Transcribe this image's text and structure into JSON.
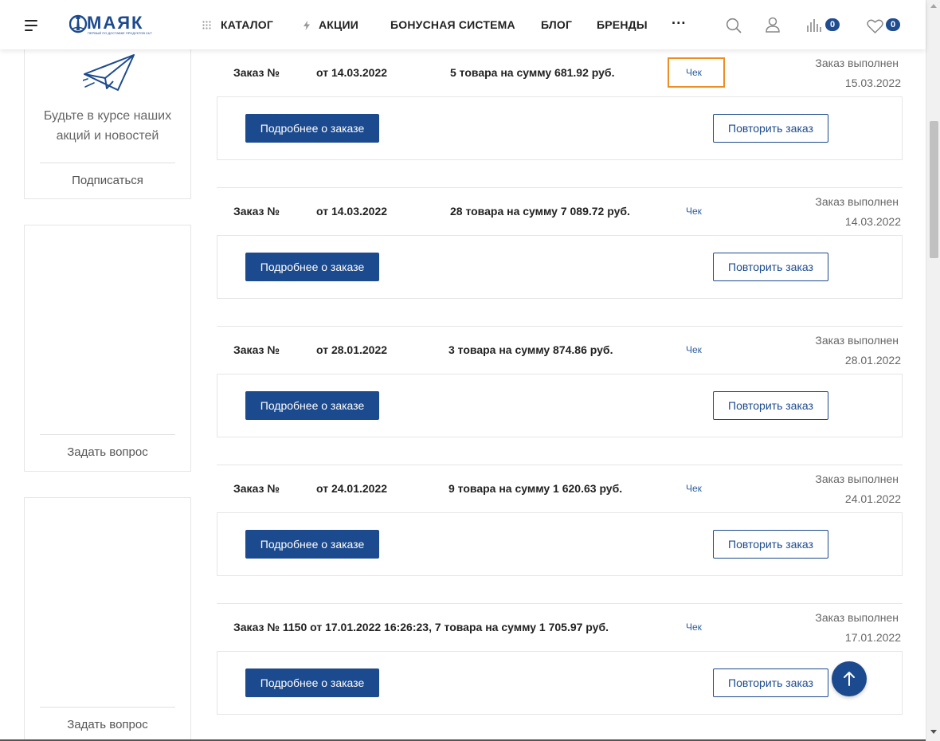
{
  "header": {
    "logo_text": "МАЯК",
    "logo_tagline": "ПЕРВЫЙ ПО ДОСТАВКЕ ПРОДУКТОВ 24/7",
    "nav": [
      {
        "label": "КАТАЛОГ",
        "icon": "grid-icon"
      },
      {
        "label": "АКЦИИ",
        "icon": "lightning-icon"
      },
      {
        "label": "БОНУСНАЯ СИСТЕМА"
      },
      {
        "label": "БЛОГ"
      },
      {
        "label": "БРЕНДЫ"
      }
    ],
    "more_label": "···",
    "compare_count": "0",
    "favorites_count": "0"
  },
  "sidebar": {
    "subscribe_text_line1": "Будьте в курсе наших",
    "subscribe_text_line2": "акций и новостей",
    "subscribe_link": "Подписаться",
    "ask_question_1": "Задать вопрос",
    "ask_question_2": "Задать вопрос"
  },
  "orders": [
    {
      "label": "Заказ №",
      "date": "от 14.03.2022",
      "summary": "5 товара на сумму 681.92 руб.",
      "check": "Чек",
      "status": "Заказ выполнен",
      "status_date": "15.03.2022",
      "details_btn": "Подробнее о заказе",
      "repeat_btn": "Повторить заказ"
    },
    {
      "label": "Заказ №",
      "date": "от 14.03.2022",
      "summary": "28 товара на сумму 7 089.72 руб.",
      "check": "Чек",
      "status": "Заказ выполнен",
      "status_date": "14.03.2022",
      "details_btn": "Подробнее о заказе",
      "repeat_btn": "Повторить заказ"
    },
    {
      "label": "Заказ №",
      "date": "от 28.01.2022",
      "summary": "3 товара на сумму 874.86 руб.",
      "check": "Чек",
      "status": "Заказ выполнен",
      "status_date": "28.01.2022",
      "details_btn": "Подробнее о заказе",
      "repeat_btn": "Повторить заказ"
    },
    {
      "label": "Заказ №",
      "date": "от 24.01.2022",
      "summary": "9 товара на сумму 1 620.63 руб.",
      "check": "Чек",
      "status": "Заказ выполнен",
      "status_date": "24.01.2022",
      "details_btn": "Подробнее о заказе",
      "repeat_btn": "Повторить заказ"
    },
    {
      "full_line": "Заказ № 1150 от 17.01.2022 16:26:23, 7 товара на сумму 1 705.97 руб.",
      "check": "Чек",
      "status": "Заказ выполнен",
      "status_date": "17.01.2022",
      "details_btn": "Подробнее о заказе",
      "repeat_btn": "Повторить заказ"
    }
  ],
  "colors": {
    "brand": "#1c4a8e",
    "highlight": "#ef8c22"
  }
}
